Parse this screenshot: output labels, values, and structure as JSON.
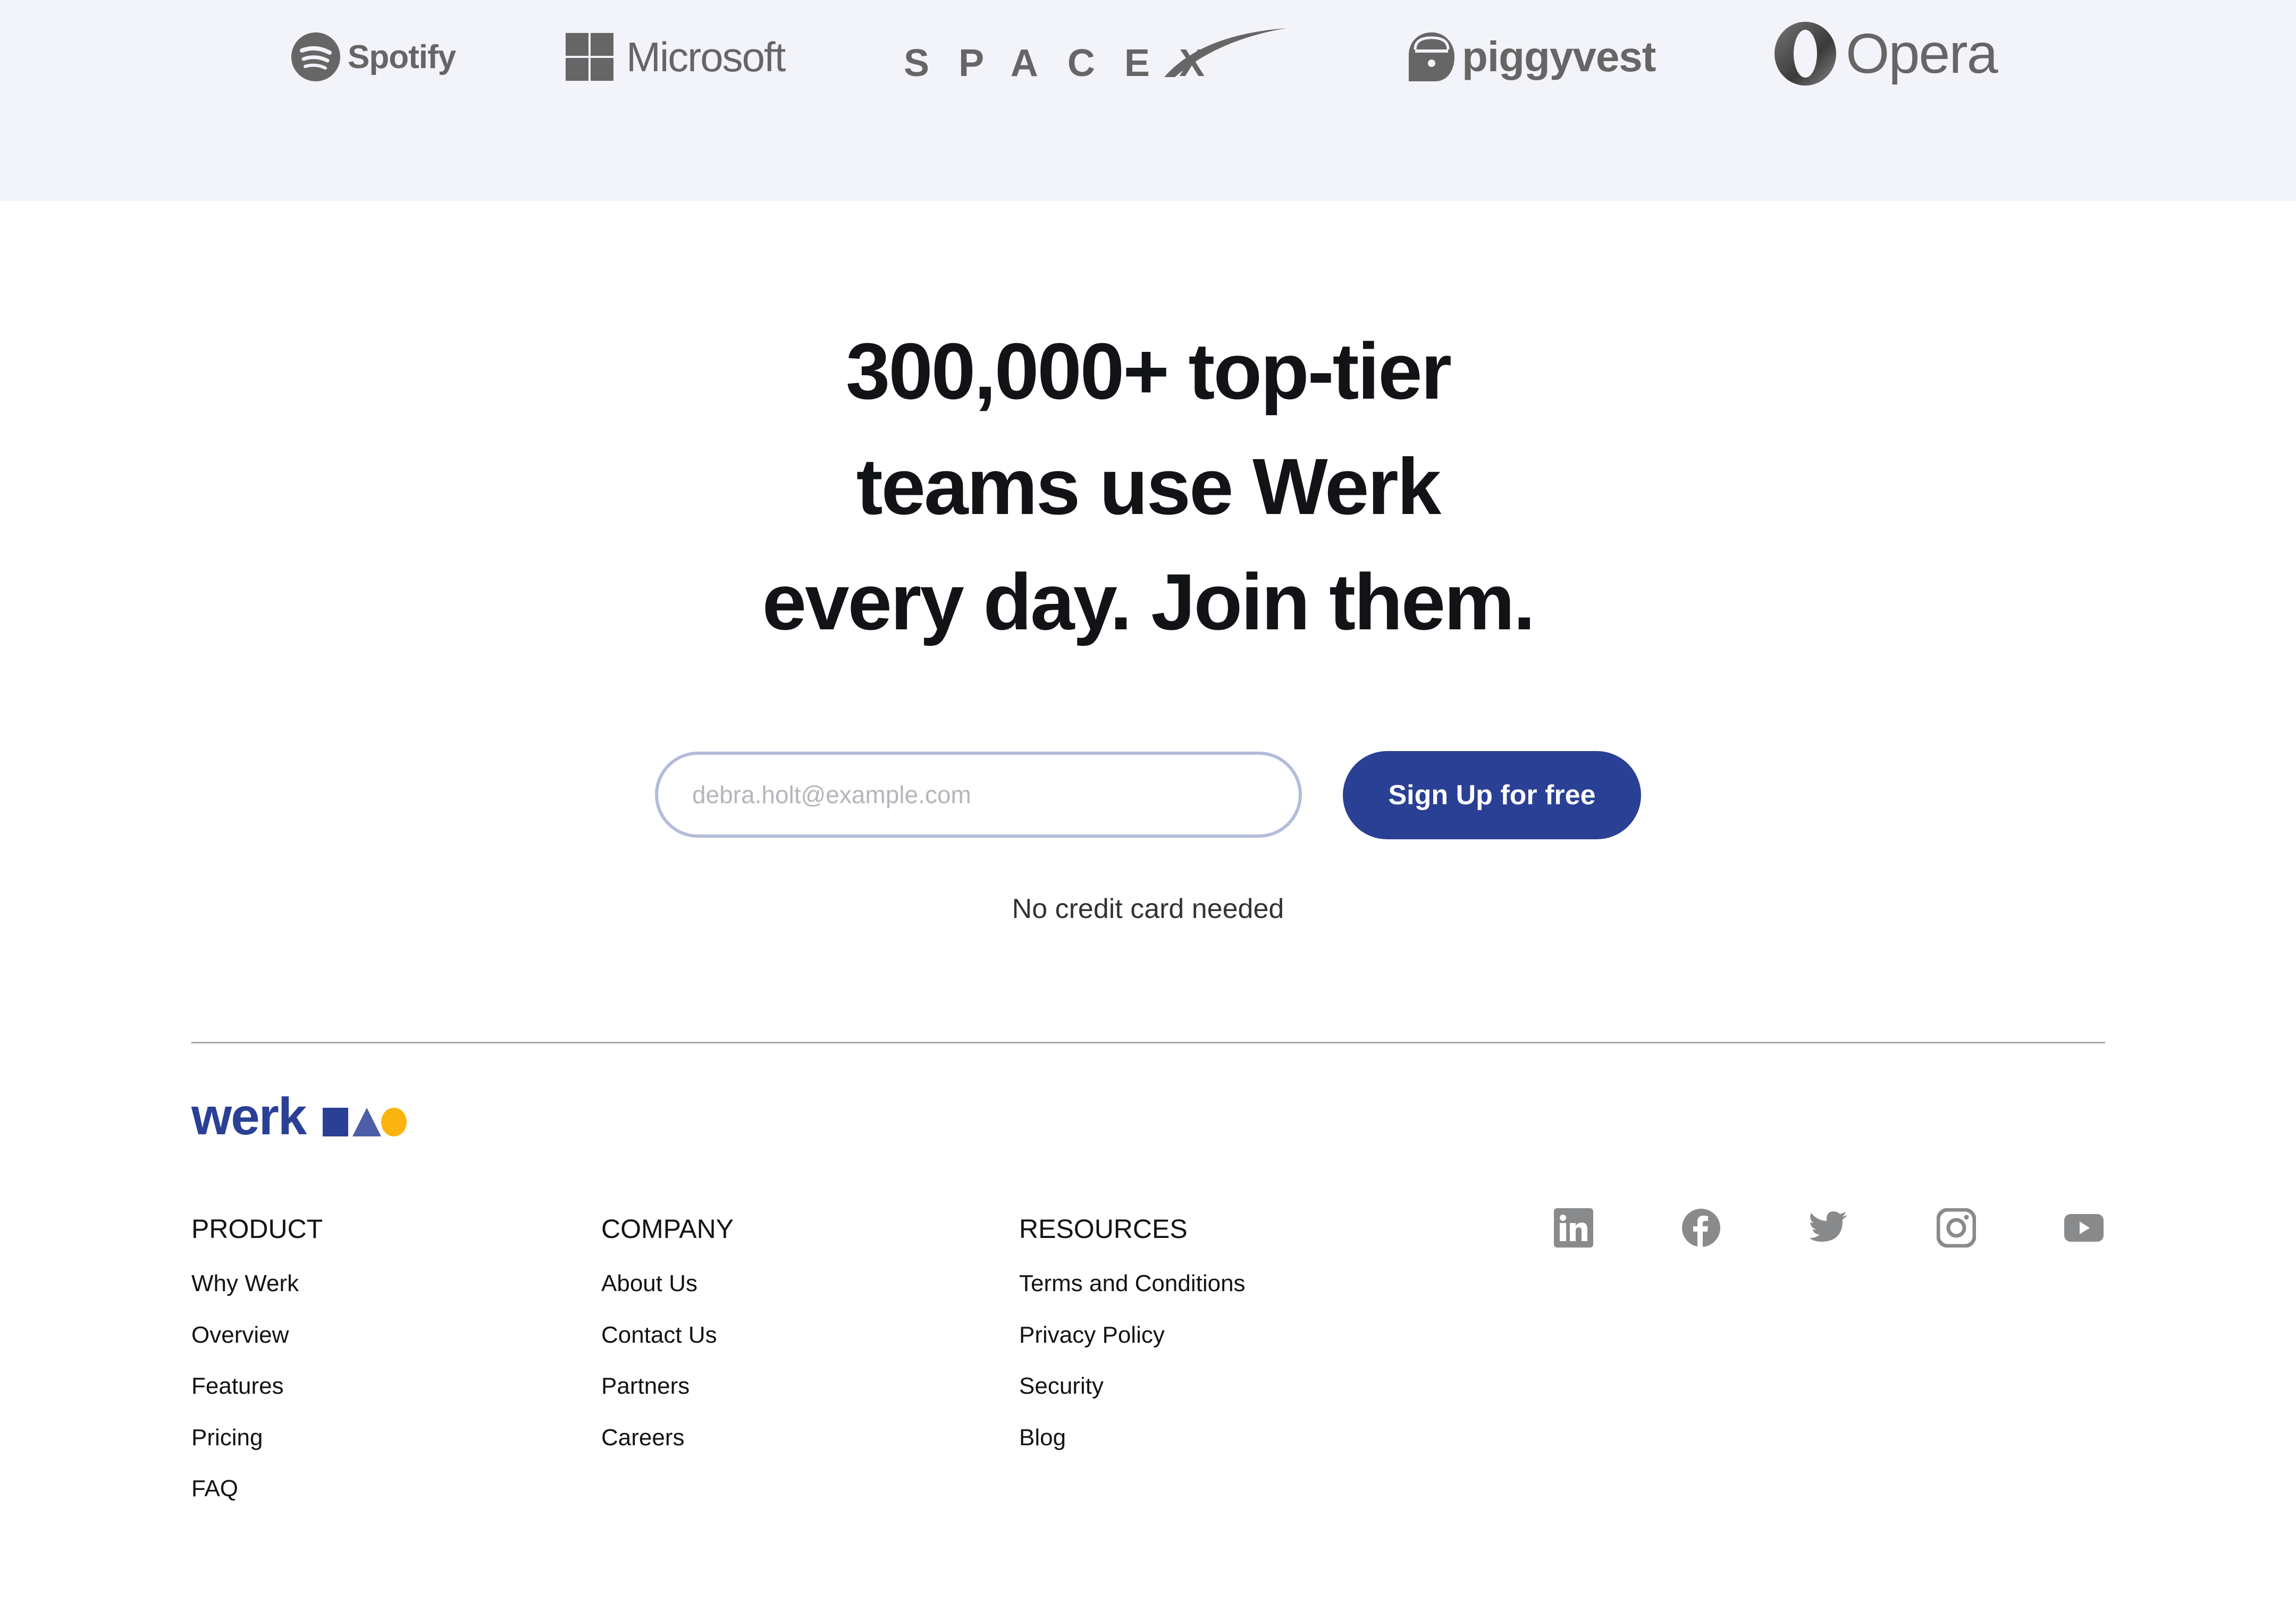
{
  "logos": {
    "spotify": {
      "name": "Spotify",
      "icon": "spotify-icon"
    },
    "microsoft": {
      "name": "Microsoft",
      "icon": "microsoft-grid-icon"
    },
    "spacex": {
      "name": "SPACEX",
      "icon": "spacex-swoosh-icon"
    },
    "piggyvest": {
      "name": "piggyvest",
      "icon": "padlock-icon"
    },
    "opera": {
      "name": "Opera",
      "icon": "opera-o-icon"
    }
  },
  "hero": {
    "lines": [
      "300,000+ top-tier",
      "teams use Werk",
      "every day. Join them."
    ]
  },
  "signup": {
    "email_placeholder": "debra.holt@example.com",
    "email_value": "",
    "button_label": "Sign Up for free",
    "note": "No credit card needed"
  },
  "footer": {
    "brand": "werk",
    "brand_shapes": [
      "square",
      "triangle",
      "circle"
    ],
    "colors": {
      "brand_blue": "#2a4095",
      "triangle_blue": "#4c5fa6",
      "accent_yellow": "#fbb40f"
    },
    "columns": [
      {
        "title": "PRODUCT",
        "links": [
          "Why Werk",
          "Overview",
          "Features",
          "Pricing",
          "FAQ"
        ]
      },
      {
        "title": "COMPANY",
        "links": [
          "About Us",
          "Contact Us",
          "Partners",
          "Careers"
        ]
      },
      {
        "title": "RESOURCES",
        "links": [
          "Terms and Conditions",
          "Privacy Policy",
          "Security",
          "Blog"
        ]
      }
    ],
    "social": [
      "linkedin-icon",
      "facebook-icon",
      "twitter-icon",
      "instagram-icon",
      "youtube-icon"
    ]
  }
}
